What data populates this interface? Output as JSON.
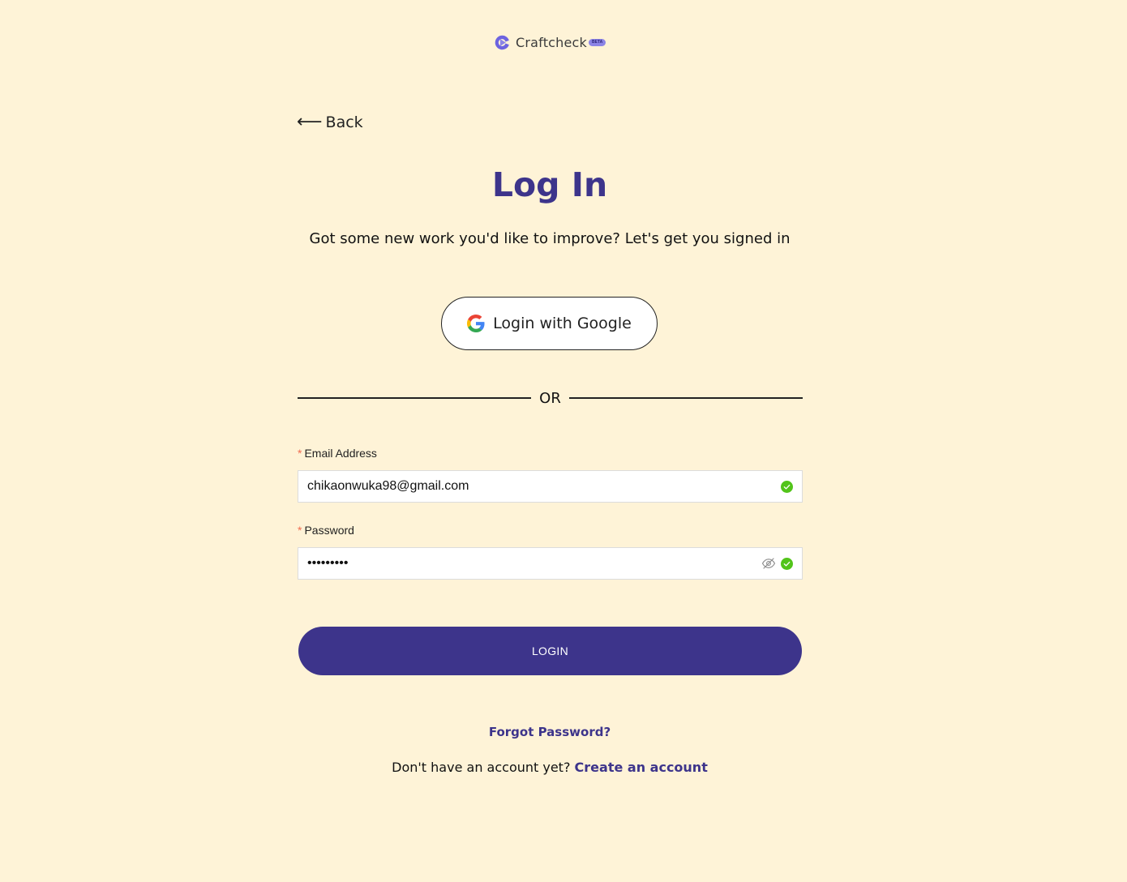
{
  "brand": {
    "name": "Craftcheck",
    "badge": "BETA",
    "accent": "#3d348b",
    "logo_color": "#6d63e0"
  },
  "nav": {
    "back_label": "Back",
    "back_icon": "left-arrow-icon"
  },
  "page": {
    "title": "Log In",
    "subtitle": "Got some new work you'd like to improve? Let's get you signed in",
    "background": "#fef3d7"
  },
  "google": {
    "label": "Login with Google",
    "icon": "google-icon"
  },
  "divider": {
    "text": "OR"
  },
  "form": {
    "email": {
      "label": "Email Address",
      "required_mark": "*",
      "value": "chikaonwuka98@gmail.com",
      "status_icon": "check-circle-icon",
      "status_color": "#52c41a"
    },
    "password": {
      "label": "Password",
      "required_mark": "*",
      "value": "•••••••••",
      "toggle_icon": "eye-hidden-icon",
      "status_icon": "check-circle-icon",
      "status_color": "#52c41a"
    },
    "submit_label": "LOGIN"
  },
  "footer": {
    "forgot_label": "Forgot Password?",
    "signup_prompt": "Don't have an account yet?",
    "signup_link": "Create an account"
  }
}
